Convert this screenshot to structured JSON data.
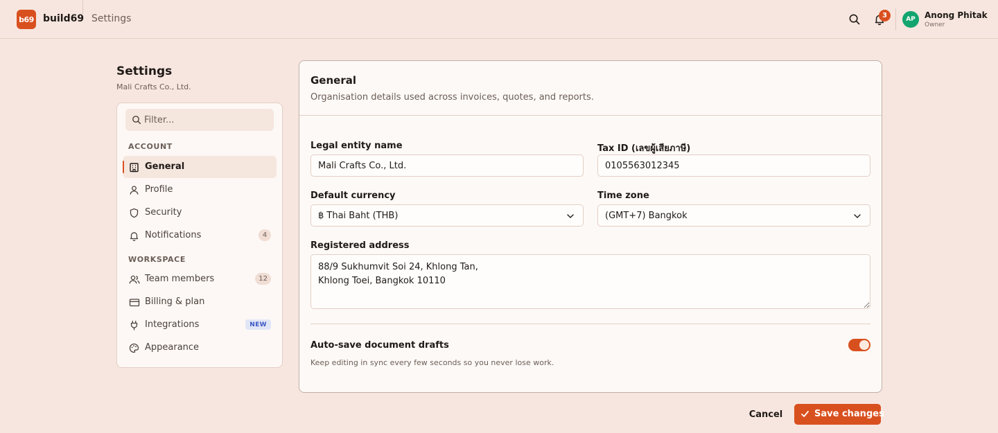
{
  "app": {
    "logo_text": "b69",
    "name": "build69",
    "breadcrumb": "Settings"
  },
  "topbar": {
    "notifications_count": "3",
    "user": {
      "initials": "AP",
      "name": "Anong Phitak",
      "role": "Owner",
      "avatar_color": "#13a46f"
    },
    "icons": [
      "search-icon",
      "bell-icon"
    ]
  },
  "sidebar": {
    "title": "Settings",
    "subtitle": "Mali Crafts Co., Ltd.",
    "filter_placeholder": "Filter...",
    "sections": [
      {
        "label": "ACCOUNT",
        "items": [
          {
            "label": "General",
            "icon": "building-icon",
            "active": true
          },
          {
            "label": "Profile",
            "icon": "user-icon"
          },
          {
            "label": "Security",
            "icon": "shield-icon"
          },
          {
            "label": "Notifications",
            "icon": "bell-icon",
            "count": "4"
          }
        ]
      },
      {
        "label": "WORKSPACE",
        "items": [
          {
            "label": "Team members",
            "icon": "users-icon",
            "count": "12"
          },
          {
            "label": "Billing & plan",
            "icon": "credit-card-icon"
          },
          {
            "label": "Integrations",
            "icon": "plug-icon",
            "badge": "NEW"
          },
          {
            "label": "Appearance",
            "icon": "palette-icon"
          }
        ]
      }
    ]
  },
  "main": {
    "title": "General",
    "description": "Organisation details used across invoices, quotes, and reports.",
    "fields": {
      "legal_name": {
        "label": "Legal entity name",
        "value": "Mali Crafts Co., Ltd."
      },
      "tax_id": {
        "label": "Tax ID (เลขผู้เสียภาษี)",
        "value": "0105563012345"
      },
      "currency": {
        "label": "Default currency",
        "value": "฿ Thai Baht (THB)"
      },
      "timezone": {
        "label": "Time zone",
        "value": "(GMT+7) Bangkok"
      },
      "address": {
        "label": "Registered address",
        "value": "88/9 Sukhumvit Soi 24, Khlong Tan,\nKhlong Toei, Bangkok 10110"
      }
    },
    "autosave": {
      "title": "Auto-save document drafts",
      "description": "Keep editing in sync every few seconds so you never lose work.",
      "enabled": true
    }
  },
  "actions": {
    "cancel": "Cancel",
    "save": "Save changes"
  },
  "colors": {
    "accent": "#d9501f",
    "background": "#f7e6df",
    "card": "#fdf9f6"
  }
}
